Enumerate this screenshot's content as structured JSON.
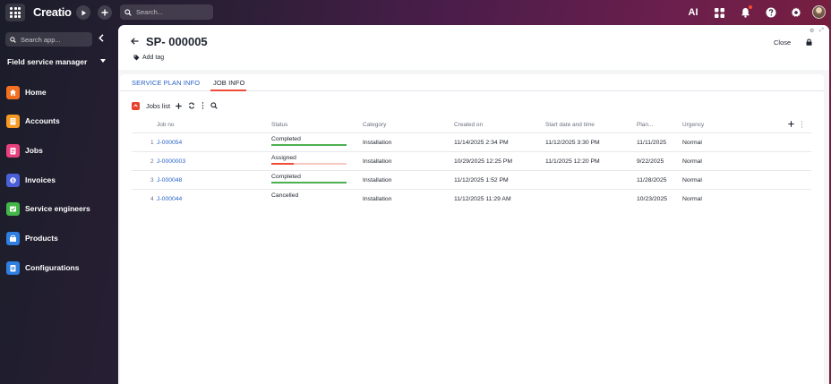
{
  "app": {
    "brand": "Creatio",
    "search_placeholder": "Search...",
    "ai_label": "AI"
  },
  "sidebar": {
    "search_placeholder": "Search app...",
    "workspace": "Field service manager",
    "items": [
      {
        "label": "Home",
        "icon": "home-icon",
        "color": "#f37021"
      },
      {
        "label": "Accounts",
        "icon": "accounts-icon",
        "color": "#f59a23"
      },
      {
        "label": "Jobs",
        "icon": "jobs-icon",
        "color": "#e8407c"
      },
      {
        "label": "Invoices",
        "icon": "invoices-icon",
        "color": "#4a5fd8"
      },
      {
        "label": "Service engineers",
        "icon": "engineers-icon",
        "color": "#43b649"
      },
      {
        "label": "Products",
        "icon": "products-icon",
        "color": "#2f7fe0"
      },
      {
        "label": "Configurations",
        "icon": "configurations-icon",
        "color": "#2f7fe0"
      }
    ]
  },
  "record": {
    "title": "SP- 000005",
    "add_tag": "Add tag",
    "close": "Close"
  },
  "tabs": [
    {
      "label": "SERVICE PLAN INFO",
      "active": false
    },
    {
      "label": "JOB INFO",
      "active": true
    }
  ],
  "jobs_list": {
    "title": "Jobs list",
    "columns": [
      "Job no",
      "Status",
      "Category",
      "Created on",
      "Start date and time",
      "Plan...",
      "Urgency"
    ],
    "rows": [
      {
        "num": "1",
        "job_no": "J-000054",
        "status": "Completed",
        "progress": 1.0,
        "status_color": "#4caf50",
        "category": "Installation",
        "created_on": "11/14/2025 2:34 PM",
        "start": "11/12/2025 3:30 PM",
        "plan": "11/11/2025",
        "urgency": "Normal"
      },
      {
        "num": "2",
        "job_no": "J-0000003",
        "status": "Assigned",
        "progress": 0.3,
        "status_color": "#ef4b37",
        "category": "Installation",
        "created_on": "10/29/2025 12:25 PM",
        "start": "11/1/2025 12:20 PM",
        "plan": "9/22/2025",
        "urgency": "Normal"
      },
      {
        "num": "3",
        "job_no": "J-000048",
        "status": "Completed",
        "progress": 1.0,
        "status_color": "#4caf50",
        "category": "Installation",
        "created_on": "11/12/2025 1:52 PM",
        "start": "",
        "plan": "11/28/2025",
        "urgency": "Normal"
      },
      {
        "num": "4",
        "job_no": "J-000044",
        "status": "Cancelled",
        "progress": 0,
        "status_color": "#ffffff",
        "category": "Installation",
        "created_on": "11/12/2025 11:29 AM",
        "start": "",
        "plan": "10/23/2025",
        "urgency": "Normal"
      }
    ]
  }
}
